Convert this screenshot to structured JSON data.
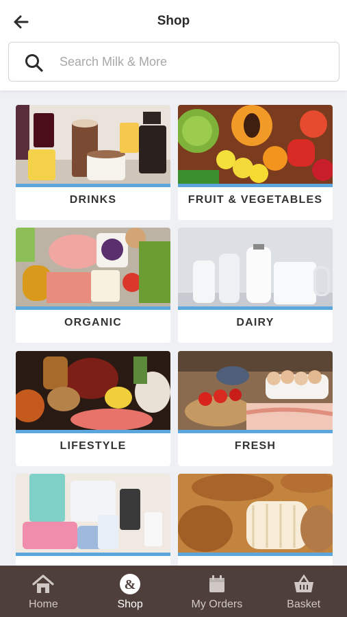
{
  "header": {
    "title": "Shop",
    "back_icon": "arrow-left-icon"
  },
  "search": {
    "placeholder": "Search Milk & More",
    "value": "",
    "icon": "search-icon"
  },
  "categories": [
    {
      "label": "DRINKS"
    },
    {
      "label": "FRUIT & VEGETABLES"
    },
    {
      "label": "ORGANIC"
    },
    {
      "label": "DAIRY"
    },
    {
      "label": "LIFESTYLE"
    },
    {
      "label": "FRESH"
    },
    {
      "label": ""
    },
    {
      "label": ""
    }
  ],
  "bottom_nav": {
    "items": [
      {
        "label": "Home",
        "icon": "home-icon",
        "active": false
      },
      {
        "label": "Shop",
        "icon": "shop-icon",
        "active": true
      },
      {
        "label": "My Orders",
        "icon": "calendar-icon",
        "active": false
      },
      {
        "label": "Basket",
        "icon": "basket-icon",
        "active": false
      }
    ]
  },
  "colors": {
    "accent_bar": "#5aa6dd",
    "nav_background": "#4f3f3a",
    "page_background": "#eef0f3"
  }
}
